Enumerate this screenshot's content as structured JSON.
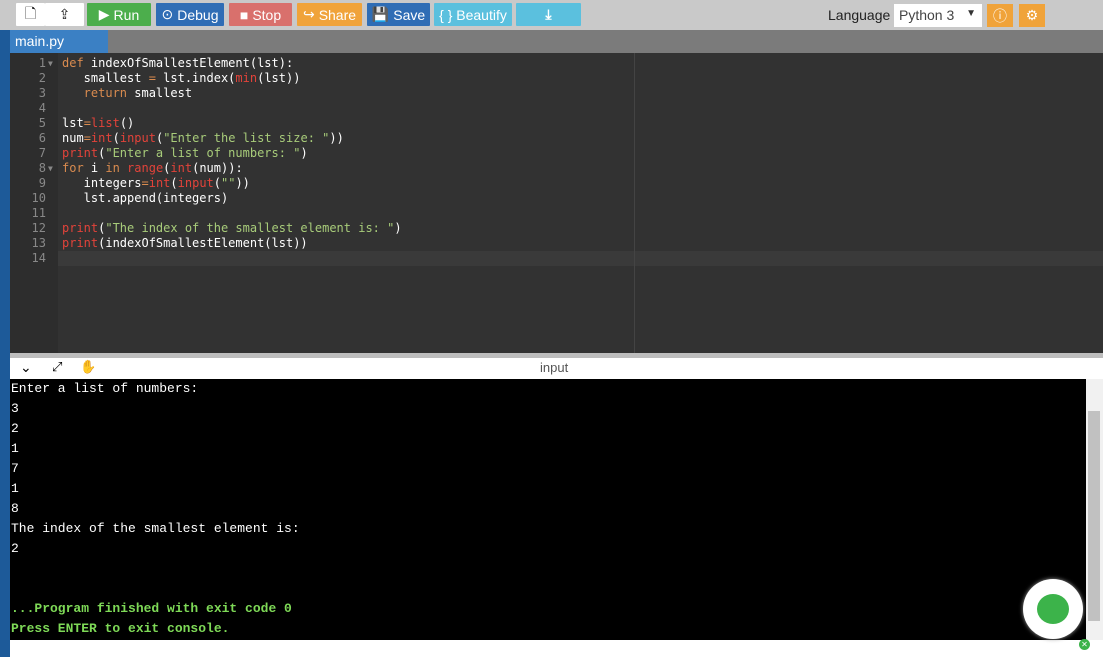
{
  "toolbar": {
    "run": "Run",
    "debug": "Debug",
    "stop": "Stop",
    "share": "Share",
    "save": "Save",
    "beautify": "{ } Beautify",
    "language_label": "Language",
    "language_value": "Python 3"
  },
  "tab": {
    "label": "main.py"
  },
  "code": [
    [
      [
        "kw",
        "def "
      ],
      [
        "pl",
        "indexOfSmallestElement(lst):"
      ]
    ],
    [
      [
        "pl",
        "   smallest "
      ],
      [
        "kw",
        "="
      ],
      [
        "pl",
        " lst.index("
      ],
      [
        "bi",
        "min"
      ],
      [
        "pl",
        "(lst))"
      ]
    ],
    [
      [
        "kw",
        "   return "
      ],
      [
        "pl",
        "smallest"
      ]
    ],
    [],
    [
      [
        "pl",
        "lst"
      ],
      [
        "kw",
        "="
      ],
      [
        "bi",
        "list"
      ],
      [
        "pl",
        "()"
      ]
    ],
    [
      [
        "pl",
        "num"
      ],
      [
        "kw",
        "="
      ],
      [
        "bi",
        "int"
      ],
      [
        "pl",
        "("
      ],
      [
        "bi",
        "input"
      ],
      [
        "pl",
        "("
      ],
      [
        "st",
        "\"Enter the list size: \""
      ],
      [
        "pl",
        "))"
      ]
    ],
    [
      [
        "bi",
        "print"
      ],
      [
        "pl",
        "("
      ],
      [
        "st",
        "\"Enter a list of numbers: \""
      ],
      [
        "pl",
        ")"
      ]
    ],
    [
      [
        "kw",
        "for "
      ],
      [
        "pl",
        "i "
      ],
      [
        "kw",
        "in "
      ],
      [
        "bi",
        "range"
      ],
      [
        "pl",
        "("
      ],
      [
        "bi",
        "int"
      ],
      [
        "pl",
        "(num)):"
      ]
    ],
    [
      [
        "pl",
        "   integers"
      ],
      [
        "kw",
        "="
      ],
      [
        "bi",
        "int"
      ],
      [
        "pl",
        "("
      ],
      [
        "bi",
        "input"
      ],
      [
        "pl",
        "("
      ],
      [
        "st",
        "\"\""
      ],
      [
        "pl",
        "))"
      ]
    ],
    [
      [
        "pl",
        "   lst.append(integers)"
      ]
    ],
    [],
    [
      [
        "bi",
        "print"
      ],
      [
        "pl",
        "("
      ],
      [
        "st",
        "\"The index of the smallest element is: \""
      ],
      [
        "pl",
        ")"
      ]
    ],
    [
      [
        "bi",
        "print"
      ],
      [
        "pl",
        "(indexOfSmallestElement(lst))"
      ]
    ],
    []
  ],
  "console": {
    "title": "input",
    "lines": [
      "Enter a list of numbers:",
      "3",
      "2",
      "1",
      "7",
      "1",
      "8",
      "The index of the smallest element is:",
      "2",
      "",
      ""
    ],
    "finished": "...Program finished with exit code 0",
    "press": "Press ENTER to exit console."
  },
  "colors": {
    "run": "#4cae4c",
    "debug": "#2f6db5",
    "stop": "#d9534f",
    "share": "#f0a33a",
    "save": "#2f6db5",
    "beautify": "#5bc0de"
  }
}
